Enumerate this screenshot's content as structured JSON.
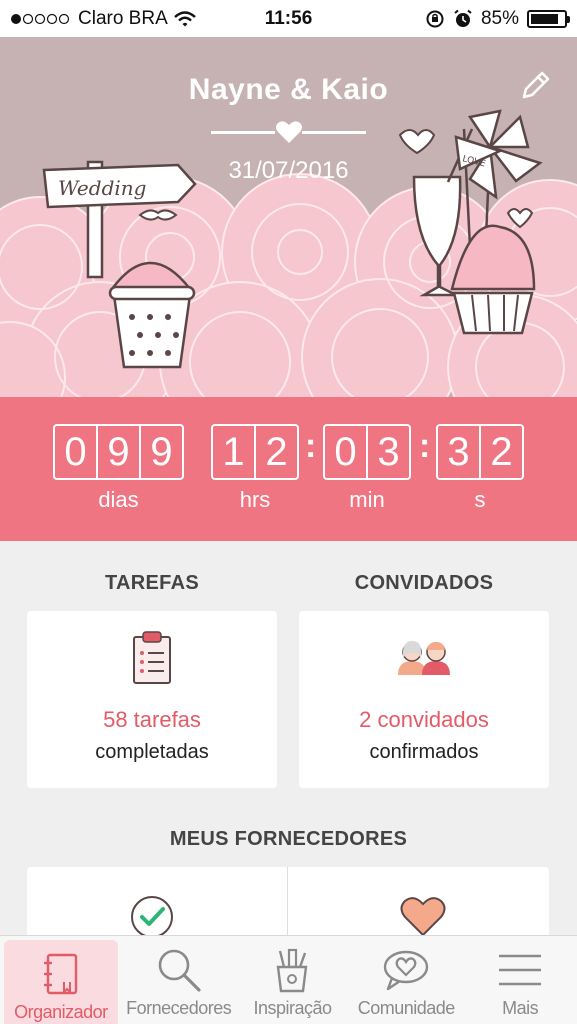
{
  "status_bar": {
    "carrier": "Claro BRA",
    "time": "11:56",
    "battery": "85%",
    "battery_level": 0.85
  },
  "header": {
    "couple": "Nayne & Kaio",
    "date": "31/07/2016",
    "sign_text": "Wedding",
    "flag_text": "LOVE"
  },
  "countdown": {
    "days": [
      "0",
      "9",
      "9"
    ],
    "hours": [
      "1",
      "2"
    ],
    "minutes": [
      "0",
      "3"
    ],
    "seconds": [
      "3",
      "2"
    ],
    "separator": ":",
    "labels": {
      "days": "dias",
      "hours": "hrs",
      "minutes": "min",
      "seconds": "s"
    }
  },
  "tasks": {
    "title": "TAREFAS",
    "count": "58 tarefas",
    "sub": "completadas",
    "icon": "clipboard-icon"
  },
  "guests": {
    "title": "CONVIDADOS",
    "count": "2 convidados",
    "sub": "confirmados",
    "icon": "couple-icon"
  },
  "vendors": {
    "title": "MEUS FORNECEDORES",
    "icons": [
      "checkmark-icon",
      "heart-icon"
    ]
  },
  "tabs": [
    {
      "label": "Organizador",
      "icon": "notebook-icon",
      "active": true
    },
    {
      "label": "Fornecedores",
      "icon": "search-icon",
      "active": false
    },
    {
      "label": "Inspiração",
      "icon": "pencil-cup-icon",
      "active": false
    },
    {
      "label": "Comunidade",
      "icon": "chat-heart-icon",
      "active": false
    },
    {
      "label": "Mais",
      "icon": "menu-icon",
      "active": false
    }
  ],
  "colors": {
    "accent": "#f07583",
    "header_bg": "#c7b2b3",
    "flower": "#f6c7cf",
    "text_accent": "#e35b67",
    "check_green": "#2bb673",
    "heart_peach": "#f4a98a"
  }
}
